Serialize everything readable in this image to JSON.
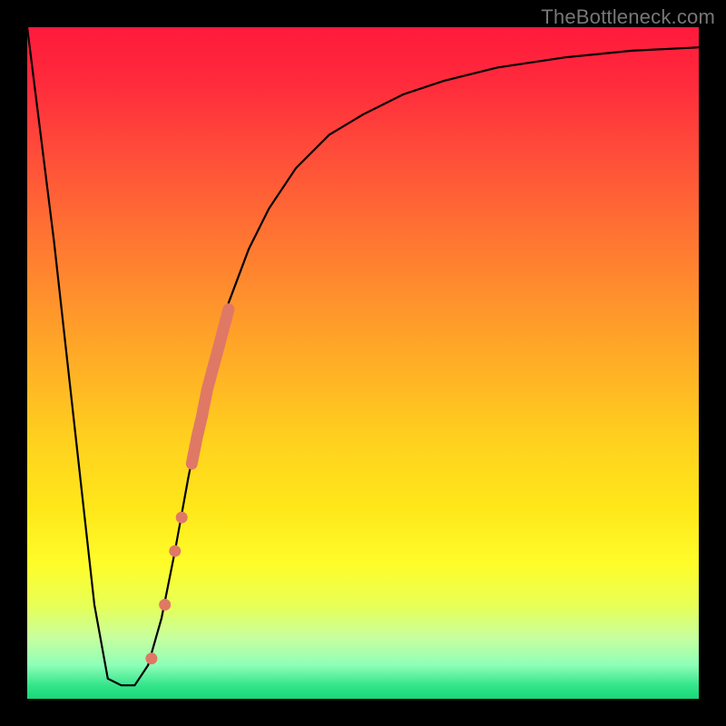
{
  "watermark": "TheBottleneck.com",
  "chart_data": {
    "type": "line",
    "title": "",
    "xlabel": "",
    "ylabel": "",
    "xlim": [
      0,
      100
    ],
    "ylim": [
      0,
      100
    ],
    "grid": false,
    "background_gradient": {
      "top_color": "#ff1a3c",
      "bottom_color": "#18d878",
      "meaning": "red=high bottleneck, green=low bottleneck"
    },
    "series": [
      {
        "name": "bottleneck-curve",
        "color": "#000000",
        "x": [
          0,
          2,
          4,
          6,
          8,
          10,
          12,
          14,
          16,
          18,
          20,
          22,
          24,
          26,
          28,
          30,
          33,
          36,
          40,
          45,
          50,
          56,
          62,
          70,
          80,
          90,
          100
        ],
        "y": [
          100,
          84,
          68,
          50,
          32,
          14,
          3,
          2,
          2,
          5,
          12,
          22,
          33,
          43,
          52,
          59,
          67,
          73,
          79,
          84,
          87,
          90,
          92,
          94,
          95.5,
          96.5,
          97
        ]
      }
    ],
    "highlighted_points": {
      "color": "#e07866",
      "points": [
        {
          "x": 18.5,
          "y": 6
        },
        {
          "x": 20.5,
          "y": 14
        },
        {
          "x": 22.0,
          "y": 22
        },
        {
          "x": 23.0,
          "y": 27
        },
        {
          "x": 24.5,
          "y": 35
        },
        {
          "x": 25.3,
          "y": 39
        },
        {
          "x": 26.0,
          "y": 42
        },
        {
          "x": 26.8,
          "y": 46
        },
        {
          "x": 27.6,
          "y": 49
        },
        {
          "x": 28.4,
          "y": 52
        },
        {
          "x": 29.2,
          "y": 55
        },
        {
          "x": 30.0,
          "y": 58
        }
      ]
    }
  }
}
